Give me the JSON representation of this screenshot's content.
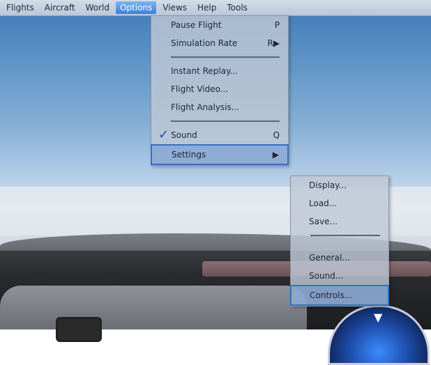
{
  "menubar": {
    "items": [
      {
        "label": "Flights"
      },
      {
        "label": "Aircraft"
      },
      {
        "label": "World"
      },
      {
        "label": "Options"
      },
      {
        "label": "Views"
      },
      {
        "label": "Help"
      },
      {
        "label": "Tools"
      }
    ]
  },
  "options_menu": {
    "pause_flight": {
      "label": "Pause Flight",
      "shortcut": "P"
    },
    "simulation_rate": {
      "label": "Simulation Rate",
      "shortcut": "R"
    },
    "instant_replay": {
      "label": "Instant Replay..."
    },
    "flight_video": {
      "label": "Flight Video..."
    },
    "flight_analysis": {
      "label": "Flight Analysis..."
    },
    "sound": {
      "label": "Sound",
      "shortcut": "Q",
      "checked": true
    },
    "settings": {
      "label": "Settings"
    }
  },
  "settings_submenu": {
    "display": {
      "label": "Display..."
    },
    "load": {
      "label": "Load..."
    },
    "save": {
      "label": "Save..."
    },
    "general": {
      "label": "General..."
    },
    "sound": {
      "label": "Sound..."
    },
    "controls": {
      "label": "Controls..."
    }
  },
  "colors": {
    "menu_highlight": "#3a80d8",
    "selection_border": "#3a6fc0"
  }
}
